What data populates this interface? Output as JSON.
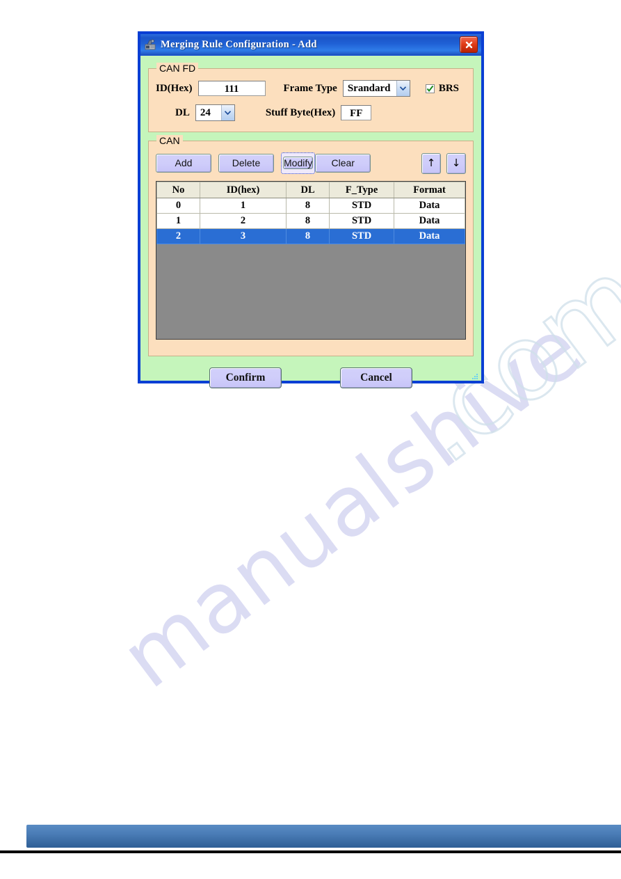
{
  "window": {
    "title": "Merging Rule Configuration - Add",
    "icon": "app-device-icon",
    "close_label": "×",
    "titlebar_color": "#1f60d5",
    "body_color": "#c5f5bb",
    "border_color": "#0a3fd4"
  },
  "canfd": {
    "group_label": "CAN FD",
    "id_label": "ID(Hex)",
    "id_value": "111",
    "frame_type_label": "Frame Type",
    "frame_type_value": "Srandard",
    "brs_label": "BRS",
    "brs_checked": true,
    "dl_label": "DL",
    "dl_value": "24",
    "stuff_byte_label": "Stuff Byte(Hex)",
    "stuff_byte_value": "FF"
  },
  "can": {
    "group_label": "CAN",
    "buttons": {
      "add": "Add",
      "delete": "Delete",
      "modify": "Modify",
      "clear": "Clear",
      "move_up": "↑",
      "move_down": "↓"
    },
    "focused_button": "Modify",
    "table": {
      "columns": [
        "No",
        "ID(hex)",
        "DL",
        "F_Type",
        "Format"
      ],
      "rows": [
        {
          "cells": [
            "0",
            "1",
            "8",
            "STD",
            "Data"
          ],
          "selected": false
        },
        {
          "cells": [
            "1",
            "2",
            "8",
            "STD",
            "Data"
          ],
          "selected": false
        },
        {
          "cells": [
            "2",
            "3",
            "8",
            "STD",
            "Data"
          ],
          "selected": true
        }
      ],
      "selection_color": "#2a6ed4",
      "empty_area_color": "#8a8a8a"
    }
  },
  "footer": {
    "confirm": "Confirm",
    "cancel": "Cancel"
  },
  "page": {
    "watermark_text": "manualshive",
    "watermark_outline_text": ".com",
    "footer_bar_color": "#4a7cb6"
  }
}
